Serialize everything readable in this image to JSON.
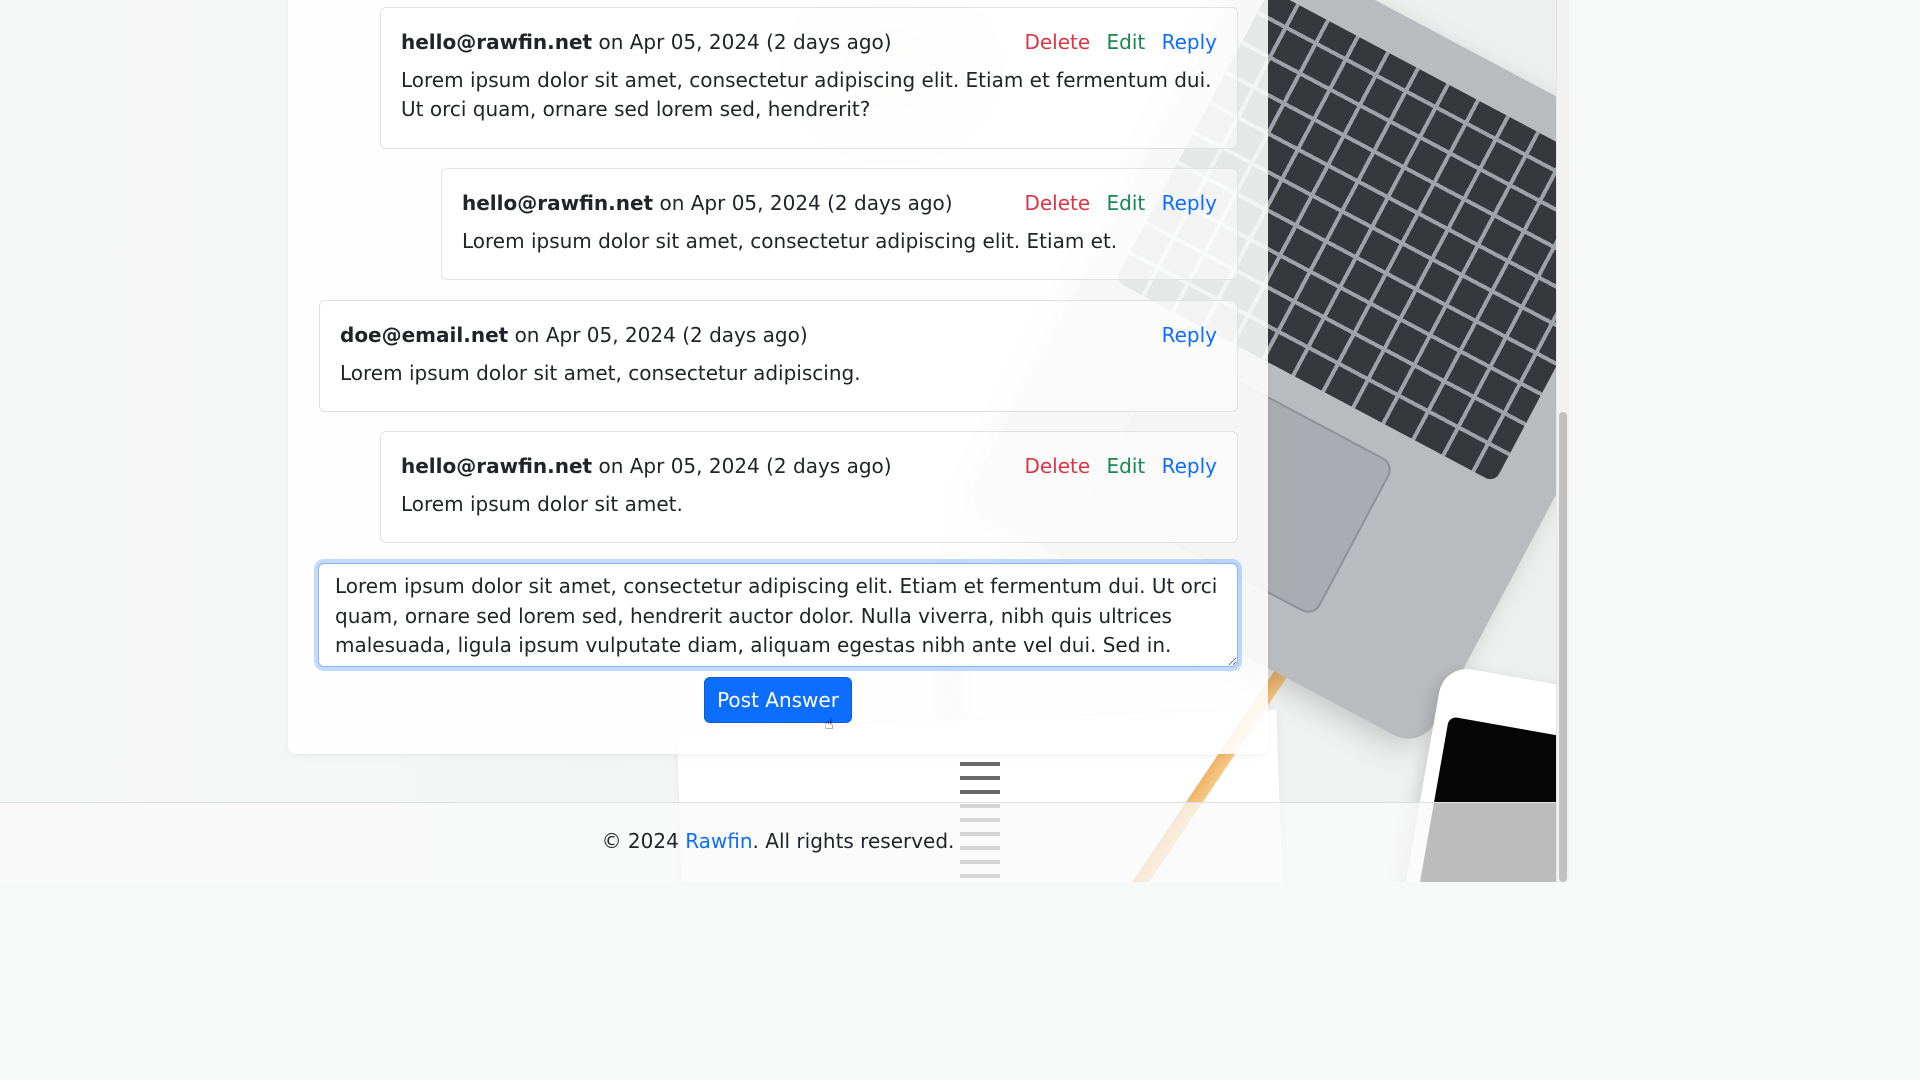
{
  "comments": [
    {
      "author": "hello@rawfin.net",
      "date": "on Apr 05, 2024 (2 days ago)",
      "actions": [
        "Delete",
        "Edit",
        "Reply"
      ],
      "body": "Lorem ipsum dolor sit amet, consectetur adipiscing elit. Etiam et fermentum dui. Ut orci quam, ornare sed lorem sed, hendrerit?"
    },
    {
      "author": "hello@rawfin.net",
      "date": "on Apr 05, 2024 (2 days ago)",
      "actions": [
        "Delete",
        "Edit",
        "Reply"
      ],
      "body": "Lorem ipsum dolor sit amet, consectetur adipiscing elit. Etiam et."
    },
    {
      "author": "doe@email.net",
      "date": "on Apr 05, 2024 (2 days ago)",
      "actions": [
        "Reply"
      ],
      "body": "Lorem ipsum dolor sit amet, consectetur adipiscing."
    },
    {
      "author": "hello@rawfin.net",
      "date": "on Apr 05, 2024 (2 days ago)",
      "actions": [
        "Delete",
        "Edit",
        "Reply"
      ],
      "body": "Lorem ipsum dolor sit amet."
    }
  ],
  "answer": {
    "value": "Lorem ipsum dolor sit amet, consectetur adipiscing elit. Etiam et fermentum dui. Ut orci quam, ornare sed lorem sed, hendrerit auctor dolor. Nulla viverra, nibh quis ultrices malesuada, ligula ipsum vulputate diam, aliquam egestas nibh ante vel dui. Sed in.",
    "button_label": "Post Answer"
  },
  "footer": {
    "prefix": "© 2024 ",
    "brand": "Rawfin",
    "suffix": ". All rights reserved."
  },
  "colors": {
    "delete": "#dc3545",
    "edit": "#198754",
    "reply": "#0d6efd",
    "primary": "#0d6efd"
  }
}
